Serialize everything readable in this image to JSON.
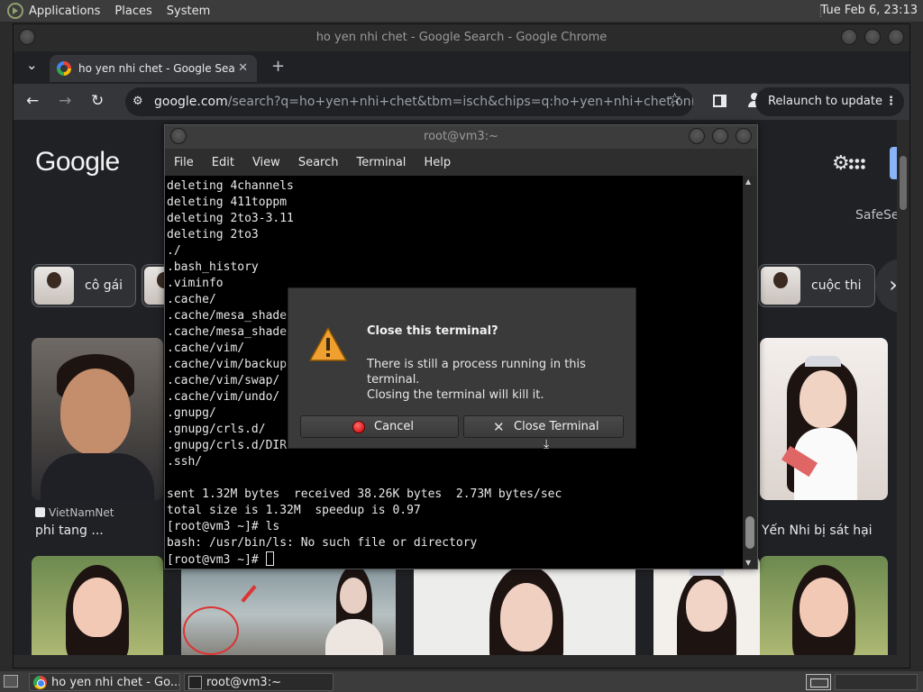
{
  "top_panel": {
    "menus": [
      "Applications",
      "Places",
      "System"
    ],
    "clock": "Tue Feb  6, 23:13"
  },
  "chrome": {
    "window_title": "ho yen nhi chet - Google Search - Google Chrome",
    "tab_title": "ho yen nhi chet - Google Sea",
    "tab_close": "✕",
    "new_tab": "+",
    "tab_list": "⌄",
    "url_host": "google.com",
    "url_path": "/search?q=ho+yen+nhi+chet&tbm=isch&chips=q:ho+yen+nhi+chet,online_c...",
    "relaunch_label": "Relaunch to update",
    "back": "←",
    "forward": "→",
    "reload": "↻",
    "star": "☆",
    "google": {
      "logo": "Google",
      "safesearch": "SafeSear",
      "chips": [
        {
          "label": "cô gái"
        },
        {
          "label": "cuộc thi"
        }
      ],
      "chip_next": "›",
      "images": [
        {
          "source": "VietNamNet",
          "caption": "phi tang ..."
        },
        {
          "caption": "Yến Nhi bị sát hại"
        }
      ]
    }
  },
  "terminal": {
    "title": "root@vm3:~",
    "menus": [
      "File",
      "Edit",
      "View",
      "Search",
      "Terminal",
      "Help"
    ],
    "lines": [
      "deleting 4channels",
      "deleting 411toppm",
      "deleting 2to3-3.11",
      "deleting 2to3",
      "./",
      ".bash_history",
      ".viminfo",
      ".cache/",
      ".cache/mesa_shade",
      ".cache/mesa_shade",
      ".cache/vim/",
      ".cache/vim/backup",
      ".cache/vim/swap/",
      ".cache/vim/undo/",
      ".gnupg/",
      ".gnupg/crls.d/",
      ".gnupg/crls.d/DIR",
      ".ssh/",
      "",
      "sent 1.32M bytes  received 38.26K bytes  2.73M bytes/sec",
      "total size is 1.32M  speedup is 0.97",
      "[root@vm3 ~]# ls",
      "bash: /usr/bin/ls: No such file or directory"
    ],
    "prompt": "[root@vm3 ~]# "
  },
  "dialog": {
    "heading": "Close this terminal?",
    "message_line1": "There is still a process running in this terminal.",
    "message_line2": "Closing the terminal will kill it.",
    "cancel_label": "Cancel",
    "close_label": "Close Terminal"
  },
  "taskbar": {
    "tasks": [
      {
        "label": "ho yen nhi chet - Go..."
      },
      {
        "label": "root@vm3:~"
      }
    ]
  }
}
